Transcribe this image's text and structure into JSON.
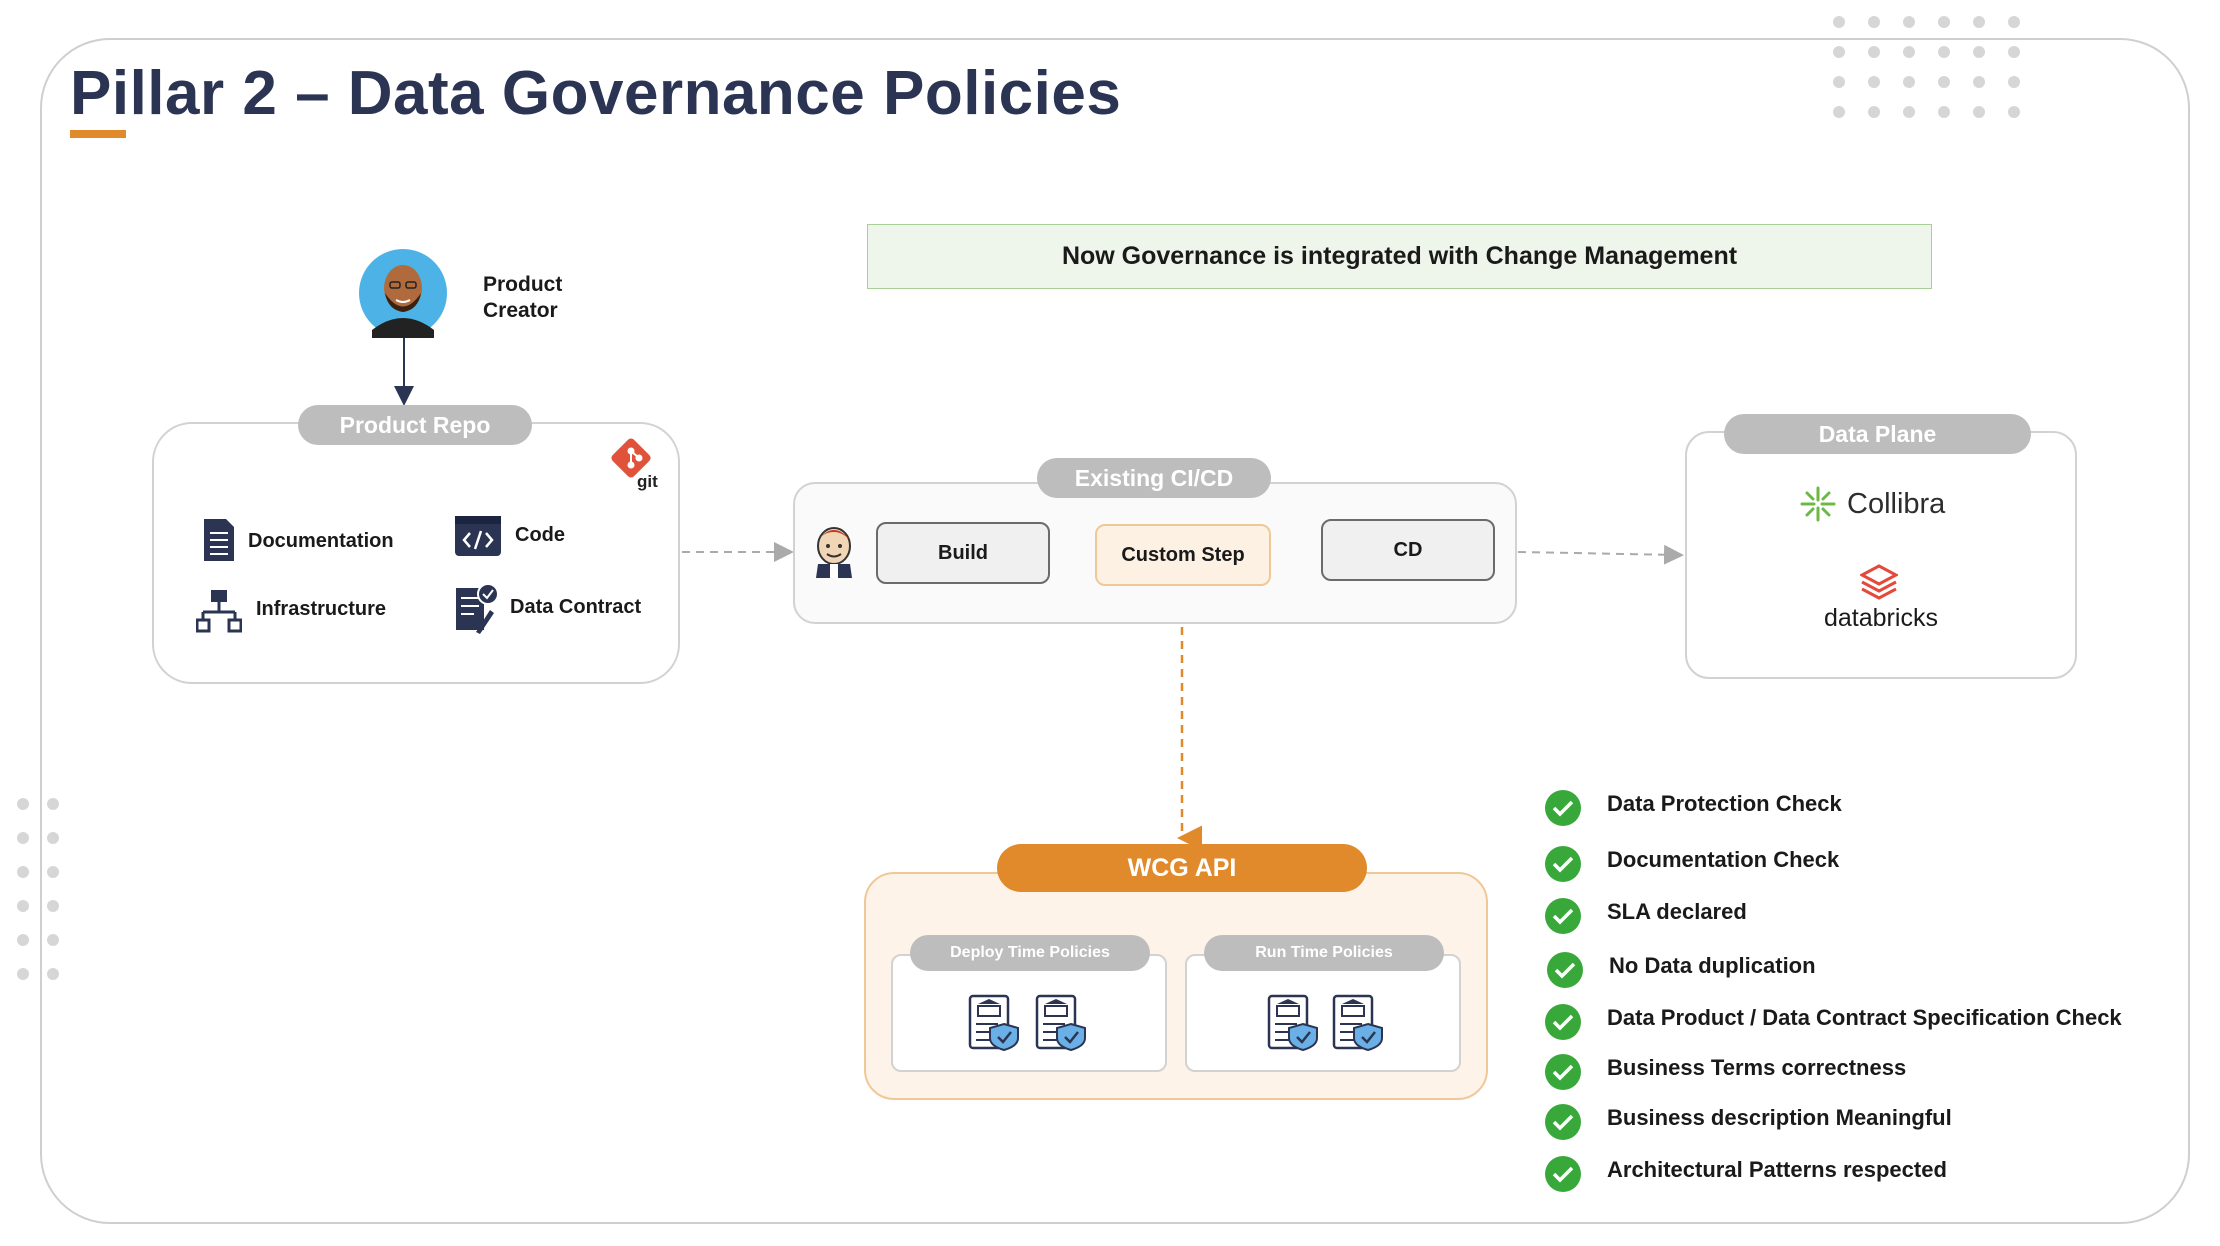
{
  "title": "Pillar 2 – Data Governance Policies",
  "banner": "Now Governance is integrated with Change Management",
  "creator": {
    "line1": "Product",
    "line2": "Creator"
  },
  "product_repo": {
    "label": "Product Repo",
    "git_label": "git",
    "items": [
      "Documentation",
      "Code",
      "Infrastructure",
      "Data Contract"
    ]
  },
  "cicd": {
    "label": "Existing CI/CD",
    "steps": [
      "Build",
      "Custom Step",
      "CD"
    ]
  },
  "data_plane": {
    "label": "Data Plane",
    "tools": [
      "Collibra",
      "databricks"
    ]
  },
  "wcg": {
    "label": "WCG API",
    "deploy_label": "Deploy Time Policies",
    "run_label": "Run Time Policies"
  },
  "checks": [
    "Data Protection Check",
    "Documentation Check",
    "SLA declared",
    "No Data duplication",
    "Data Product / Data Contract Specification Check",
    "Business Terms correctness",
    "Business description Meaningful",
    "Architectural Patterns respected"
  ],
  "colors": {
    "accent": "#e08a2b",
    "title": "#2b3553",
    "check": "#37a839",
    "pill": "#bdbdbd"
  }
}
